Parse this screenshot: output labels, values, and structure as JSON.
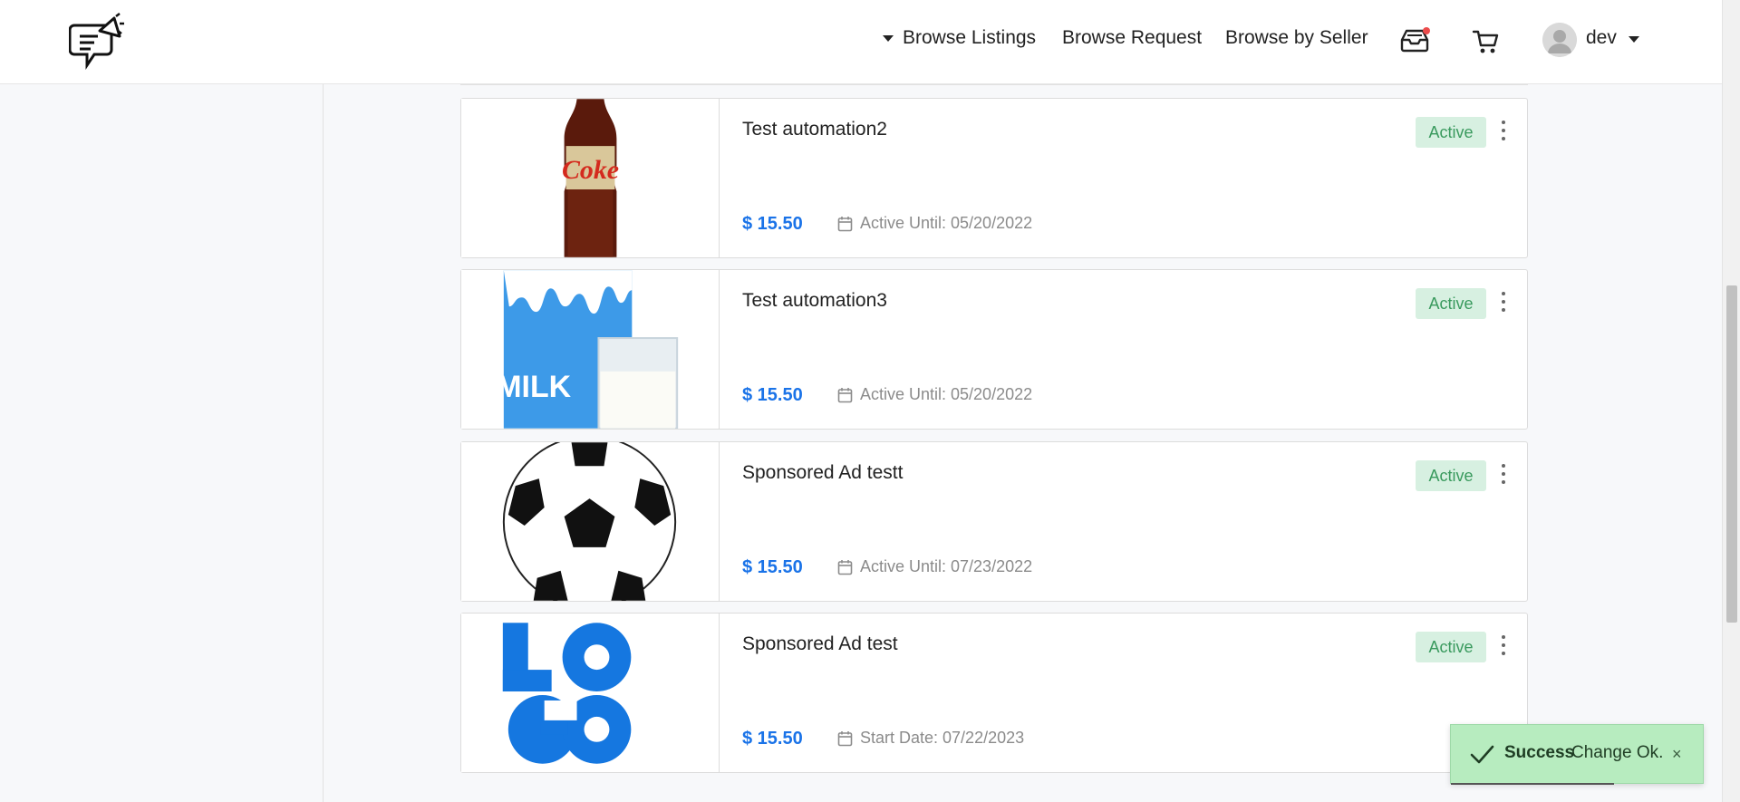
{
  "header": {
    "nav": {
      "browse_listings": "Browse Listings",
      "browse_request": "Browse Request",
      "browse_by_seller": "Browse by Seller"
    },
    "user": {
      "name": "dev"
    }
  },
  "listings": [
    {
      "title": "Test automation2",
      "price": "$ 15.50",
      "date": "Active Until: 05/20/2022",
      "status": "Active",
      "image": "coke-bottle"
    },
    {
      "title": "Test automation3",
      "price": "$ 15.50",
      "date": "Active Until: 05/20/2022",
      "status": "Active",
      "image": "milk-carton"
    },
    {
      "title": "Sponsored Ad testt",
      "price": "$ 15.50",
      "date": "Active Until: 07/23/2022",
      "status": "Active",
      "image": "soccer-ball"
    },
    {
      "title": "Sponsored Ad test",
      "price": "$ 15.50",
      "date": "Start Date: 07/22/2023",
      "status": "Active",
      "image": "logo-placeholder"
    }
  ],
  "toast": {
    "title": "Success",
    "message": "Change Ok.",
    "close": "×"
  },
  "colors": {
    "accent": "#1a73e8",
    "badge_bg": "#d7f0e1",
    "badge_text": "#3a9a5e",
    "toast_bg": "#b7ecbf"
  }
}
